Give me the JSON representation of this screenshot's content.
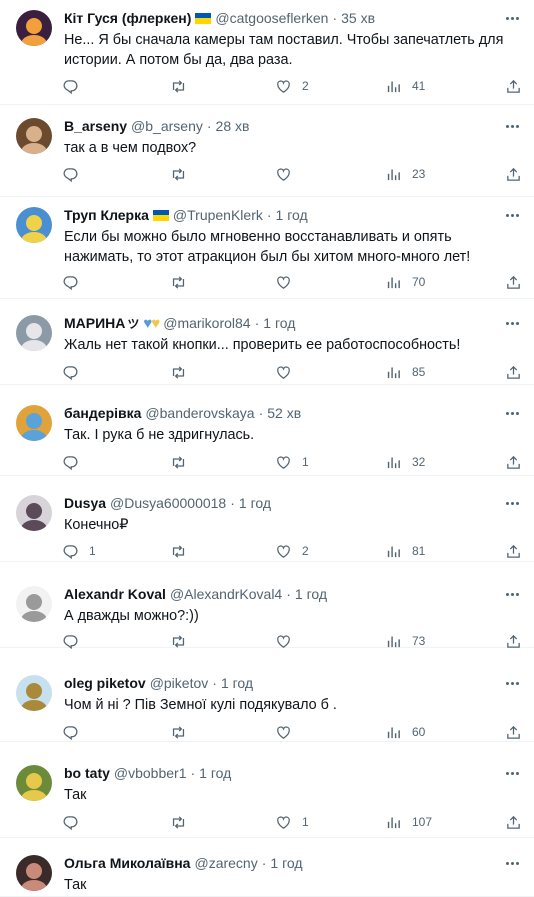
{
  "tweets": [
    {
      "name": "Кіт Гуся (флеркен)",
      "handle": "@catgooseflerken",
      "time": "35 хв",
      "text": "Не... Я бы сначала камеры там поставил. Чтобы запечатлеть для истории. А потом бы да, два раза.",
      "replies": "",
      "likes": "2",
      "views": "41",
      "flag": true
    },
    {
      "name": "B_arseny",
      "handle": "@b_arseny",
      "time": "28 хв",
      "text": "так а в чем подвох?",
      "replies": "",
      "likes": "",
      "views": "23"
    },
    {
      "name": "Труп Клерка",
      "handle": "@TrupenKlerk",
      "time": "1 год",
      "text": "Если бы можно было мгновенно восстанавливать и опять нажимать, то этот атракцион был бы хитом много-много лет!",
      "replies": "",
      "likes": "",
      "views": "70",
      "flag": true
    },
    {
      "name": "МАРИНА",
      "name_extra": "ツ",
      "handle": "@marikorol84",
      "time": "1 год",
      "text": "Жаль нет такой кнопки... проверить ее работоспособность!",
      "replies": "",
      "likes": "",
      "views": "85",
      "hearts": true
    },
    {
      "name": "бандерівка",
      "handle": "@banderovskaya",
      "time": "52 хв",
      "text": "Так. І рука б не здригнулась.",
      "replies": "",
      "likes": "1",
      "views": "32"
    },
    {
      "name": "Dusya",
      "handle": "@Dusya60000018",
      "time": "1 год",
      "text": "Конечно₽",
      "replies": "1",
      "likes": "2",
      "views": "81"
    },
    {
      "name": "Alexandr Koval",
      "handle": "@AlexandrKoval4",
      "time": "1 год",
      "text": "А дважды можно?:))",
      "replies": "",
      "likes": "",
      "views": "73"
    },
    {
      "name": "oleg piketov",
      "handle": "@piketov",
      "time": "1 год",
      "text": "Чом й ні ? Пів Земної кулі подякувало  б .",
      "replies": "",
      "likes": "",
      "views": "60"
    },
    {
      "name": "bo taty",
      "handle": "@vbobber1",
      "time": "1 год",
      "text": "Так",
      "replies": "",
      "likes": "1",
      "views": "107"
    },
    {
      "name": "Ольга Миколаївна",
      "handle": "@zarecny",
      "time": "1 год",
      "text": "Так",
      "replies": "",
      "likes": "",
      "views": ""
    }
  ],
  "colors": {
    "text": "#0f1419",
    "secondary": "#536471",
    "border": "#eff3f4",
    "flag_blue": "#0057b7",
    "flag_yellow": "#ffd700"
  }
}
